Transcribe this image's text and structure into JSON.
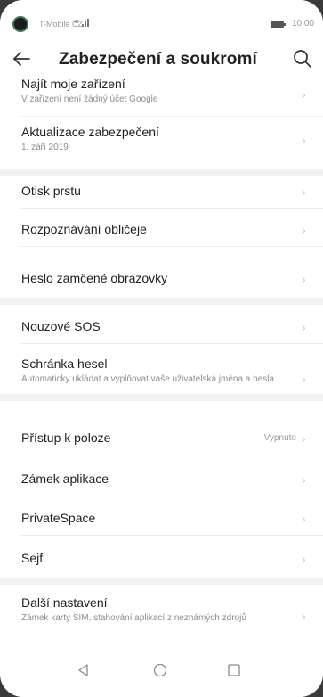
{
  "status": {
    "carrier": "T-Mobile CZ",
    "signal": "4G",
    "time": "10:00"
  },
  "appbar": {
    "title": "Zabezpečení a soukromí"
  },
  "rows": [
    {
      "label": "Najít moje zařízení",
      "sub": "V zařízení není žádný účet Google",
      "value": ""
    },
    {
      "label": "Aktualizace zabezpečení",
      "sub": "1. září 2019",
      "value": ""
    },
    {
      "label": "Otisk prstu",
      "sub": "",
      "value": ""
    },
    {
      "label": "Rozpoznávání obličeje",
      "sub": "",
      "value": ""
    },
    {
      "label": "Heslo zamčené obrazovky",
      "sub": "",
      "value": ""
    },
    {
      "label": "Nouzové SOS",
      "sub": "",
      "value": ""
    },
    {
      "label": "Schránka hesel",
      "sub": "Automaticky ukládat a vyplňovat vaše uživatelská jména a hesla",
      "value": ""
    },
    {
      "label": "Přístup k poloze",
      "sub": "",
      "value": "Vypnuto"
    },
    {
      "label": "Zámek aplikace",
      "sub": "",
      "value": ""
    },
    {
      "label": "PrivateSpace",
      "sub": "",
      "value": ""
    },
    {
      "label": "Sejf",
      "sub": "",
      "value": ""
    },
    {
      "label": "Další nastavení",
      "sub": "Zámek karty SIM, stahování aplikací z neznámých zdrojů",
      "value": ""
    }
  ],
  "icons": {
    "back": "arrow-left-icon",
    "search": "search-icon",
    "chevron": "chevron-right-icon",
    "nav_back": "triangle-back-icon",
    "nav_home": "circle-home-icon",
    "nav_recent": "square-recent-icon"
  }
}
